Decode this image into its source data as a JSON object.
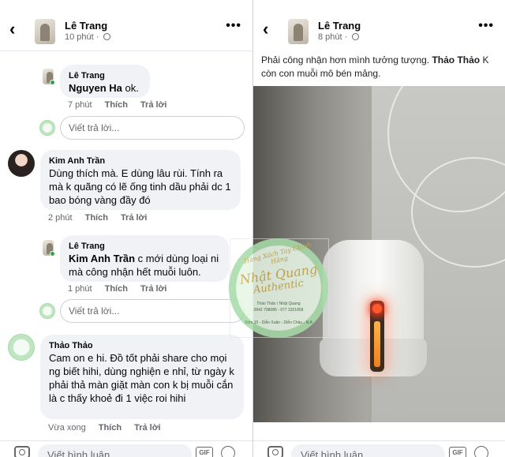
{
  "left_panel": {
    "header": {
      "author": "Lê Trang",
      "time": "10 phút"
    },
    "comments": [
      {
        "author": "Lê Trang",
        "mention": "Nguyen Ha",
        "text": " ok.",
        "time": "7 phút",
        "like": "Thích",
        "reply": "Trả lời"
      },
      {
        "reply_placeholder": "Viết trả lời..."
      },
      {
        "author": "Kim Anh Trần",
        "text": "Dùng thích mà. E dùng lâu rùi. Tính ra mà k quãng có lẽ ống tinh dầu phải dc 1 bao bóng vàng đầy đó",
        "time": "2 phút",
        "like": "Thích",
        "reply": "Trả lời"
      },
      {
        "author": "Lê Trang",
        "mention": "Kim Anh Trần",
        "text": " c mới dùng loại ni mà công nhận hết muỗi luôn.",
        "time": "1 phút",
        "like": "Thích",
        "reply": "Trả lời"
      },
      {
        "reply_placeholder": "Viết trả lời..."
      },
      {
        "author": "Thảo Thảo",
        "text": "Cam on e hi. Đồ tốt phải share cho mọi ng biết hihi, dùng nghiện e nhỉ, từ ngày k phải thả màn giặt màn con k bị muỗi cắn là c thấy khoẻ đi 1 việc roi hihi",
        "time": "Vừa xong",
        "like": "Thích",
        "reply": "Trả lời"
      }
    ],
    "bottom": {
      "placeholder": "Viết bình luận...",
      "gif": "GIF"
    }
  },
  "right_panel": {
    "header": {
      "author": "Lê Trang",
      "time": "8 phút"
    },
    "post_text": "Phải công nhận hơn mình tưởng tượng. ",
    "post_mention": "Thảo Thảo",
    "post_text_2": " K còn con muỗi mô bén mảng.",
    "bottom": {
      "placeholder": "Viết bình luận...",
      "gif": "GIF"
    }
  },
  "watermark": {
    "top": "Hàng Xách Tay Chính Hãng",
    "brand": "Nhật Quang",
    "sub": "Authentic",
    "owner": "Thảo Thảo / Nhật Quang",
    "phones": "0942 798086 - 077 3321858",
    "address": "Xóm 10 - Diễn Xuân - Diễn Châu - N.A"
  },
  "icons": {
    "back": "back-arrow-icon",
    "more": "more-dots-icon",
    "globe": "globe-icon",
    "camera": "camera-icon",
    "gif": "gif-icon",
    "sticker": "sticker-icon"
  },
  "colors": {
    "bubble": "#f0f2f5",
    "online": "#31a24c",
    "meta": "#65676b"
  }
}
